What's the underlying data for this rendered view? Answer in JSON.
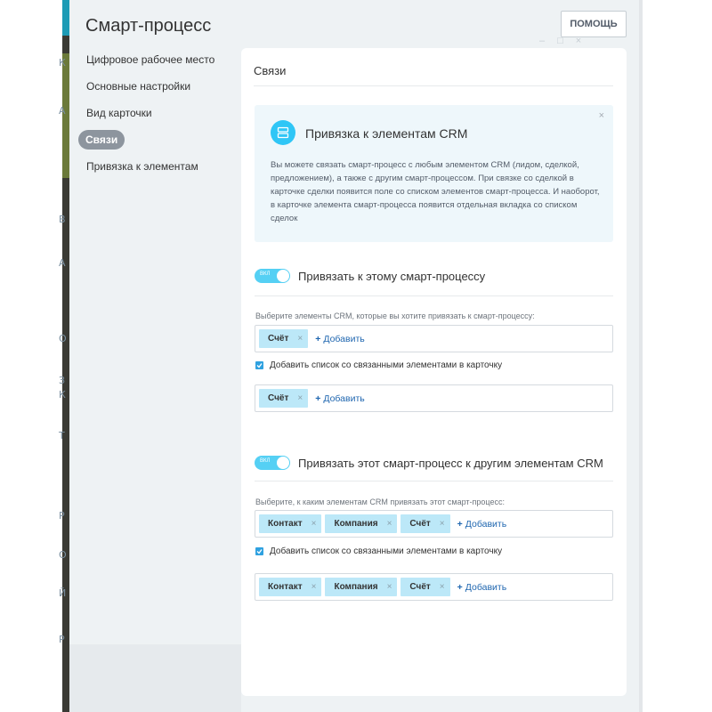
{
  "background": {
    "edge_chars": [
      "К",
      "А",
      "В",
      "А",
      "О",
      "З",
      "К",
      "Т",
      "Р",
      "О",
      "Й",
      "Р"
    ]
  },
  "slider": {
    "title": "Смарт-процесс",
    "help_label": "ПОМОЩЬ",
    "window_controls": "–□×"
  },
  "nav": {
    "items": [
      {
        "label": "Цифровое рабочее место"
      },
      {
        "label": "Основные настройки"
      },
      {
        "label": "Вид карточки"
      },
      {
        "label": "Связи",
        "active": true
      },
      {
        "label": "Привязка к элементам"
      }
    ]
  },
  "card": {
    "title": "Связи",
    "info": {
      "title": "Привязка к элементам CRM",
      "text": "Вы можете связать смарт-процесс с любым элементом CRM (лидом, сделкой, предложением), а также с другим смарт-процессом. При связке со сделкой в карточке сделки появится поле со списком элементов смарт-процесса. И наоборот, в карточке элемента смарт-процесса появится отдельная вкладка со списком сделок",
      "close": "×"
    },
    "section1": {
      "toggle_text": "ВКЛ",
      "toggle_on": true,
      "label": "Привязать к этому смарт-процессу",
      "hint": "Выберите элементы CRM, которые вы хотите привязать к смарт-процессу:",
      "tags": [
        "Счёт"
      ],
      "add_label": "Добавить",
      "checkbox_label": "Добавить список со связанными элементами в карточку",
      "checked": true,
      "card_tags": [
        "Счёт"
      ]
    },
    "section2": {
      "toggle_text": "ВКЛ",
      "toggle_on": true,
      "label": "Привязать этот смарт-процесс к другим элементам CRM",
      "hint": "Выберите, к каким элементам CRM привязать этот смарт-процесс:",
      "tags": [
        "Контакт",
        "Компания",
        "Счёт"
      ],
      "add_label": "Добавить",
      "checkbox_label": "Добавить список со связанными элементами в карточку",
      "checked": true,
      "card_tags": [
        "Контакт",
        "Компания",
        "Счёт"
      ]
    }
  },
  "colors": {
    "accent": "#2fc6f6",
    "toggle": "#55d0f4",
    "tag": "#bce8f8",
    "link": "#2067b0",
    "nav_active": "#8d959e"
  }
}
